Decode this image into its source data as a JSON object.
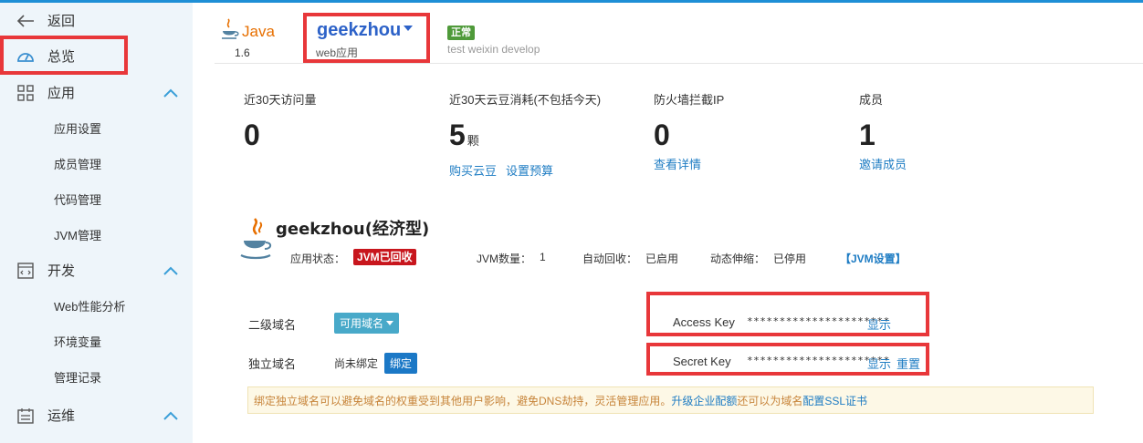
{
  "sidebar": {
    "back_label": "返回",
    "overview_label": "总览",
    "groups": [
      {
        "label": "应用",
        "items": [
          "应用设置",
          "成员管理",
          "代码管理",
          "JVM管理"
        ]
      },
      {
        "label": "开发",
        "items": [
          "Web性能分析",
          "环境变量",
          "管理记录"
        ]
      },
      {
        "label": "运维",
        "items": []
      }
    ]
  },
  "header": {
    "lang_name": "Java",
    "lang_version": "1.6",
    "app_name": "geekzhou",
    "app_type": "web应用",
    "status_badge": "正常",
    "env_labels": "test weixin develop"
  },
  "stats": {
    "visits_label": "近30天访问量",
    "visits_value": "0",
    "beans_label": "近30天云豆消耗(不包括今天)",
    "beans_value": "5",
    "beans_unit": "颗",
    "buy_beans": "购买云豆",
    "set_budget": "设置预算",
    "firewall_label": "防火墙拦截IP",
    "firewall_value": "0",
    "firewall_link": "查看详情",
    "members_label": "成员",
    "members_value": "1",
    "members_link": "邀请成员"
  },
  "app": {
    "title": "geekzhou(经济型)",
    "status_label": "应用状态：",
    "status_value": "JVM已回收",
    "jvm_count_label": "JVM数量：",
    "jvm_count_value": "1",
    "auto_recycle_label": "自动回收：",
    "auto_recycle_value": "已启用",
    "autoscale_label": "动态伸缩：",
    "autoscale_value": "已停用",
    "jvm_settings": "【JVM设置】"
  },
  "domain": {
    "subdomain_label": "二级域名",
    "subdomain_button": "可用域名",
    "custom_label": "独立域名",
    "custom_value": "尚未绑定",
    "bind_button": "绑定"
  },
  "keys": {
    "access_label": "Access Key",
    "access_value": "**********************",
    "access_show": "显示",
    "secret_label": "Secret Key",
    "secret_value": "**********************",
    "secret_show": "显示",
    "secret_reset": "重置"
  },
  "notice": {
    "text": "绑定独立域名可以避免域名的权重受到其他用户影响，避免DNS劫持，灵活管理应用。",
    "upgrade_link": "升级企业配额",
    "text2": "还可以为域名",
    "ssl_link": "配置SSL证书"
  },
  "colors": {
    "accent": "#1e8fd6",
    "highlight": "#e8373a",
    "status_ok": "#4f9a3a",
    "status_bad": "#c8161d",
    "link": "#1e7cc3"
  }
}
